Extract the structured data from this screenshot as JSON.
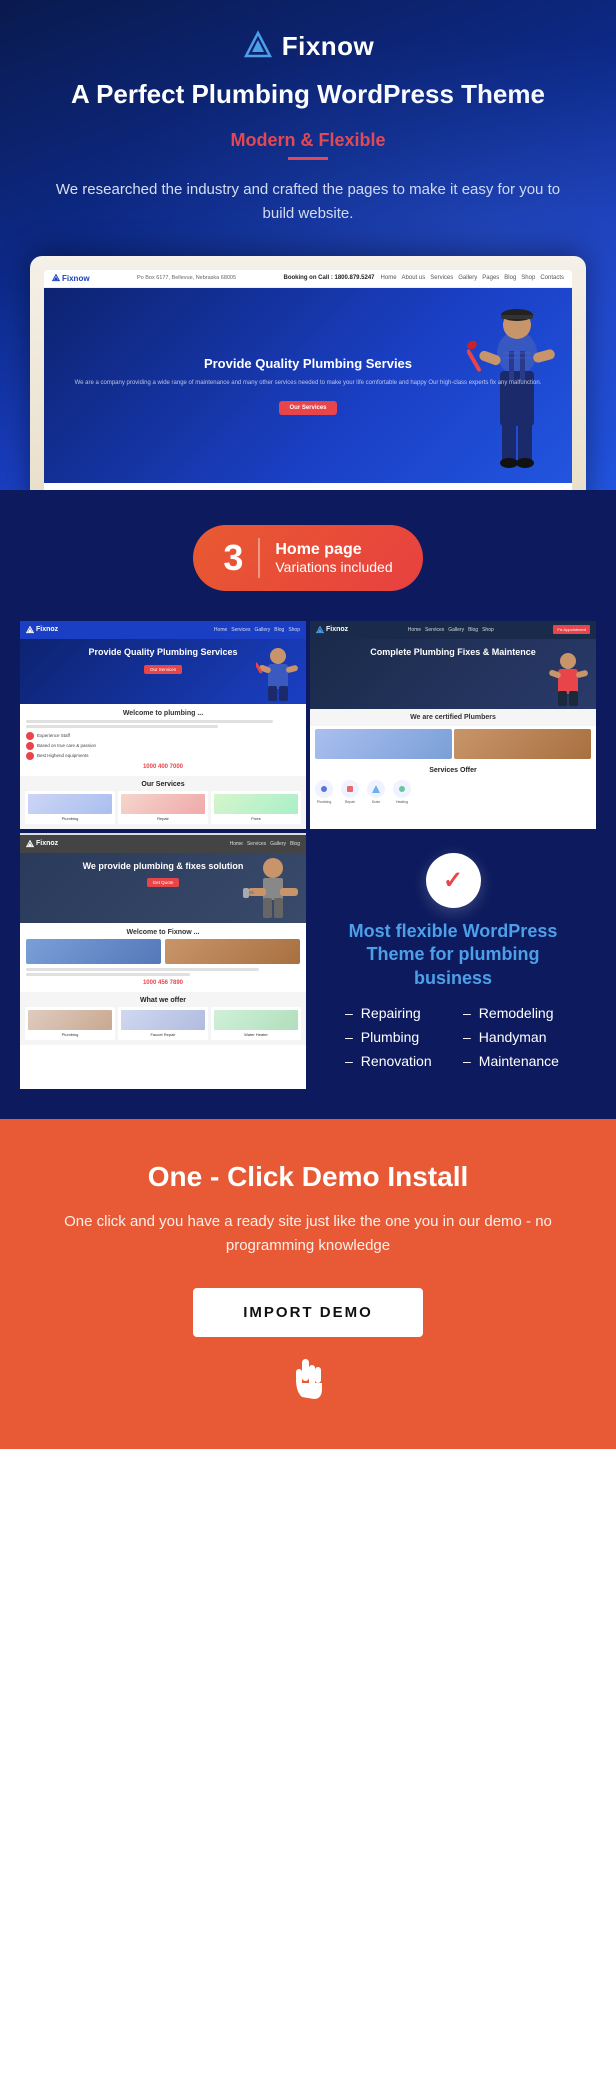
{
  "logo": {
    "text": "Fixnow",
    "icon": "△"
  },
  "header": {
    "main_title": "A Perfect Plumbing WordPress Theme",
    "subtitle": "Modern & Flexible",
    "description": "We researched the industry and crafted the pages to make it easy for you to build website.",
    "laptop": {
      "address": "Po Box 6177, Bellevue, Nebraska 68005",
      "phone": "Booking on Call : 1800.879.5247",
      "hero_title": "Provide Quality Plumbing Servies",
      "hero_desc": "We are a company providing a wide range of maintenance and many other services needed to make your life comfortable and happy Our high-class experts fix any malfunction.",
      "btn_label": "Our Services",
      "nav_links": [
        "Home",
        "About us",
        "Services",
        "Gallery",
        "Pages",
        "Blog",
        "Shop",
        "Contacts"
      ]
    }
  },
  "variations": {
    "number": "3",
    "label_line1": "Home page",
    "label_line2": "Variations included"
  },
  "screenshots": {
    "ss1": {
      "hero_title": "Provide Quality Plumbing Services",
      "section_title": "Welcome to plumbing ...",
      "features": [
        "Experience Staff",
        "Based on true care & passion",
        "Best Highend equipments"
      ],
      "phone": "1000 400 7000",
      "services_title": "Our Services"
    },
    "ss2": {
      "hero_title": "Complete Plumbing Fixes & Maintence",
      "appointment": "Fix Appointment",
      "certified": "We are certified Plumbers",
      "services_title": "Services Offer"
    },
    "ss3": {
      "hero_title": "We provide plumbing & fixes solution",
      "section_title": "Welcome to Fixnow ...",
      "what_we_offer": "What we offer"
    }
  },
  "flexible": {
    "title": "Most flexible WordPress Theme for plumbing business",
    "features": [
      "Repairing",
      "Remodeling",
      "Plumbing",
      "Handyman",
      "Renovation",
      "Maintenance"
    ]
  },
  "demo_section": {
    "title": "One - Click Demo Install",
    "description": "One click and you have a ready site just like the one you in our demo - no programming knowledge",
    "btn_label": "IMPORT DEMO"
  }
}
